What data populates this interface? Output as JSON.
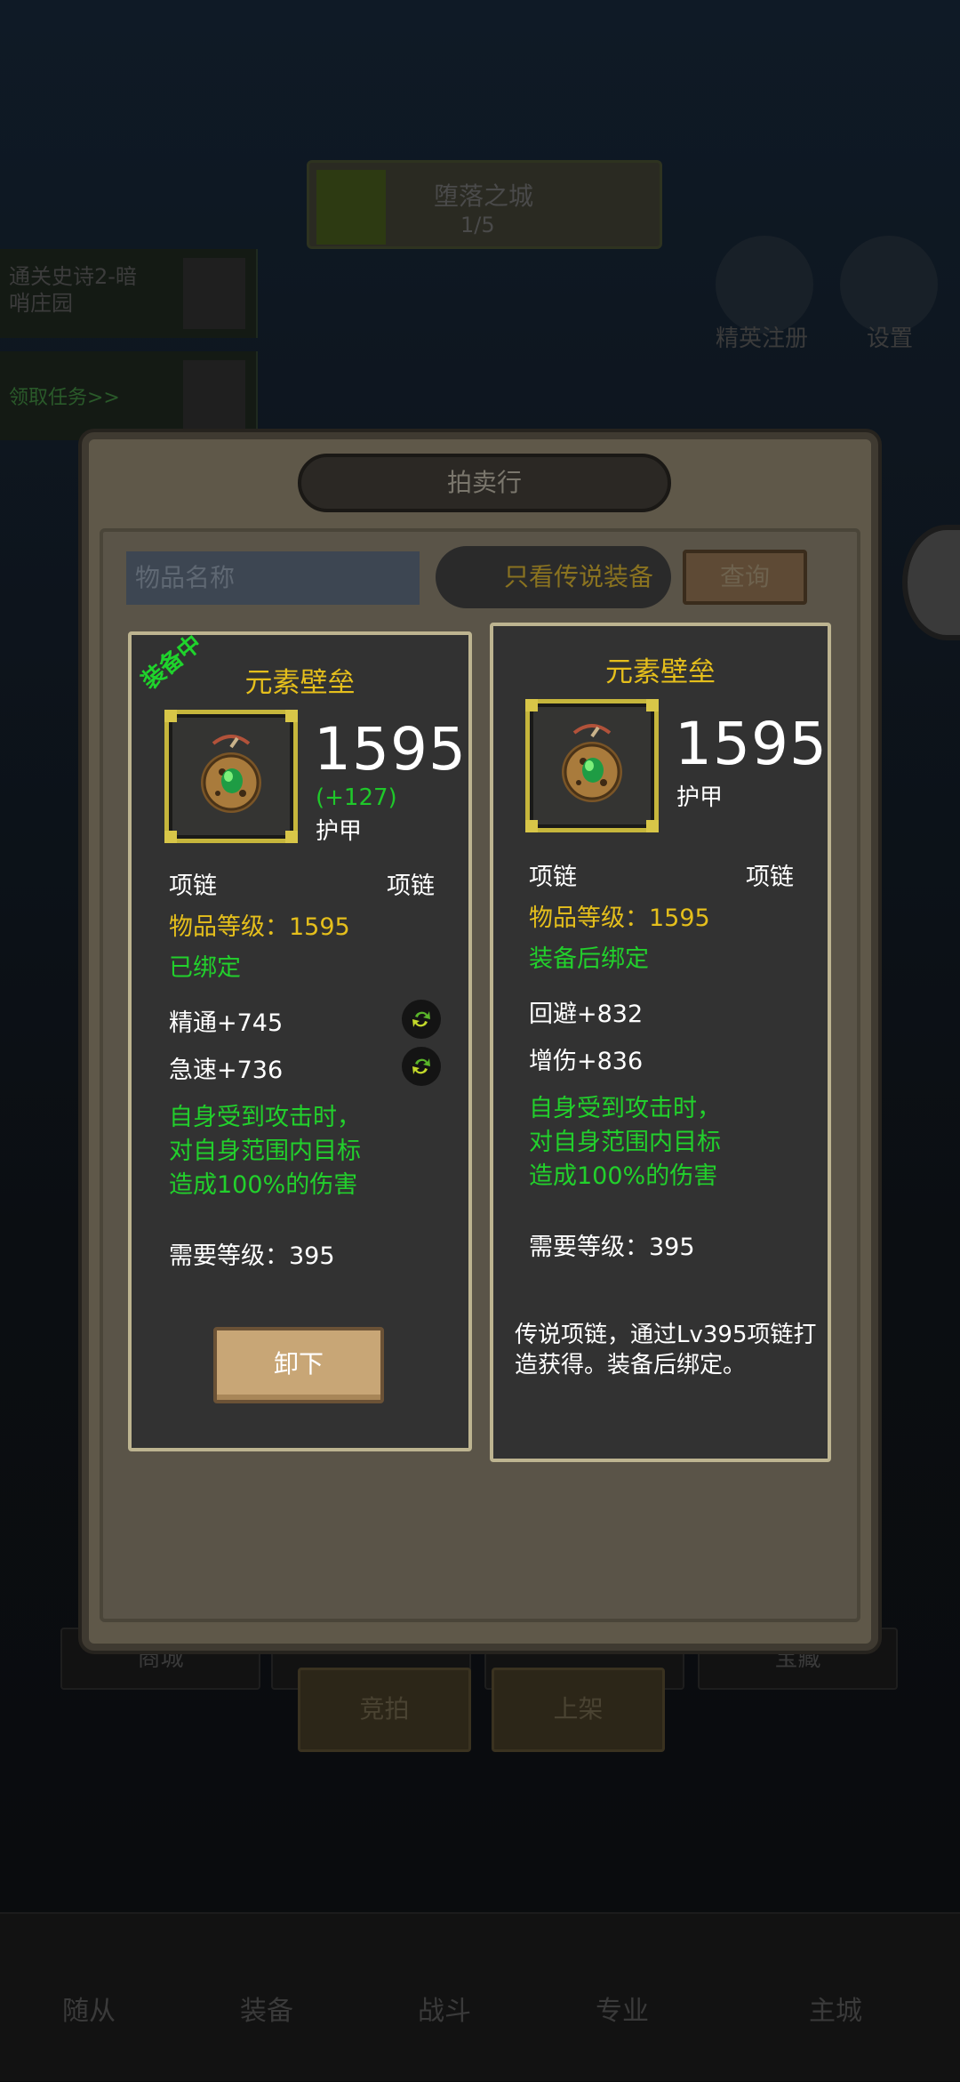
{
  "background": {
    "stage": {
      "name": "堕落之城",
      "progress": "1/5"
    },
    "quests": [
      {
        "text": "通关史诗2-暗\n哨庄园"
      },
      {
        "text": "领取任务>>"
      }
    ],
    "top_labels": {
      "guild_register": "精英注册",
      "settings": "设置"
    },
    "market_tabs": [
      "商城",
      "",
      "",
      "宝藏"
    ],
    "actions": {
      "auction": "竞拍",
      "list": "上架"
    },
    "bottom_nav": [
      "随从",
      "装备",
      "战斗",
      "专业",
      "主城"
    ]
  },
  "modal": {
    "title": "拍卖行",
    "search_placeholder": "物品名称",
    "legend_filter": "只看传说装备",
    "query_button": "查询"
  },
  "equipped_item": {
    "equipped_tag": "装备中",
    "name": "元素壁垒",
    "armor": "1595",
    "armor_delta": "(+127)",
    "armor_label": "护甲",
    "slot_left": "项链",
    "slot_right": "项链",
    "item_level": "物品等级：1595",
    "bind_status": "已绑定",
    "stats": [
      {
        "text": "精通+745"
      },
      {
        "text": "急速+736"
      }
    ],
    "effect": [
      "自身受到攻击时，",
      "对自身范围内目标",
      "造成100%的伤害"
    ],
    "required_level": "需要等级：395",
    "unequip_button": "卸下"
  },
  "compare_item": {
    "name": "元素壁垒",
    "armor": "1595",
    "armor_label": "护甲",
    "slot_left": "项链",
    "slot_right": "项链",
    "item_level": "物品等级：1595",
    "bind_status": "装备后绑定",
    "stats": [
      {
        "text": "回避+832"
      },
      {
        "text": "增伤+836"
      }
    ],
    "effect": [
      "自身受到攻击时，",
      "对自身范围内目标",
      "造成100%的伤害"
    ],
    "required_level": "需要等级：395",
    "description": "传说项链，通过Lv395项链打造获得。装备后绑定。"
  },
  "colors": {
    "gold_text": "#e5bf1c",
    "green_text": "#22d02c",
    "card_border": "#bdb490"
  }
}
